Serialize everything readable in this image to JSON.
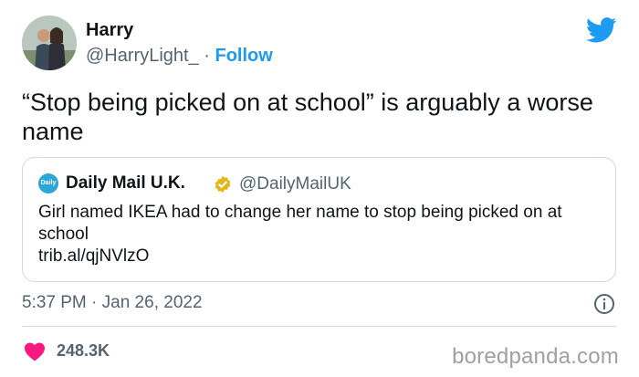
{
  "author": {
    "name": "Harry",
    "handle": "@HarryLight_",
    "separator": "·",
    "follow_label": "Follow"
  },
  "tweet": {
    "text": "“Stop being picked on at school” is arguably a worse name",
    "timestamp": "5:37 PM · Jan 26, 2022",
    "likes": "248.3K"
  },
  "quoted_tweet": {
    "logo_text": "Daily Mail",
    "name": "Daily Mail U.K.",
    "handle": "@DailyMailUK",
    "text": "Girl named IKEA had to change her name to stop being picked on at school",
    "link": "trib.al/qjNVlzO"
  },
  "watermark": "boredpanda.com",
  "icons": [
    "twitter-bird-icon",
    "verified-badge-icon",
    "info-icon",
    "heart-icon"
  ],
  "colors": {
    "accent": "#1d9bf0",
    "secondary_text": "#536471",
    "heart": "#f91880",
    "verified": "#e2b719",
    "border": "#cfd9de"
  }
}
